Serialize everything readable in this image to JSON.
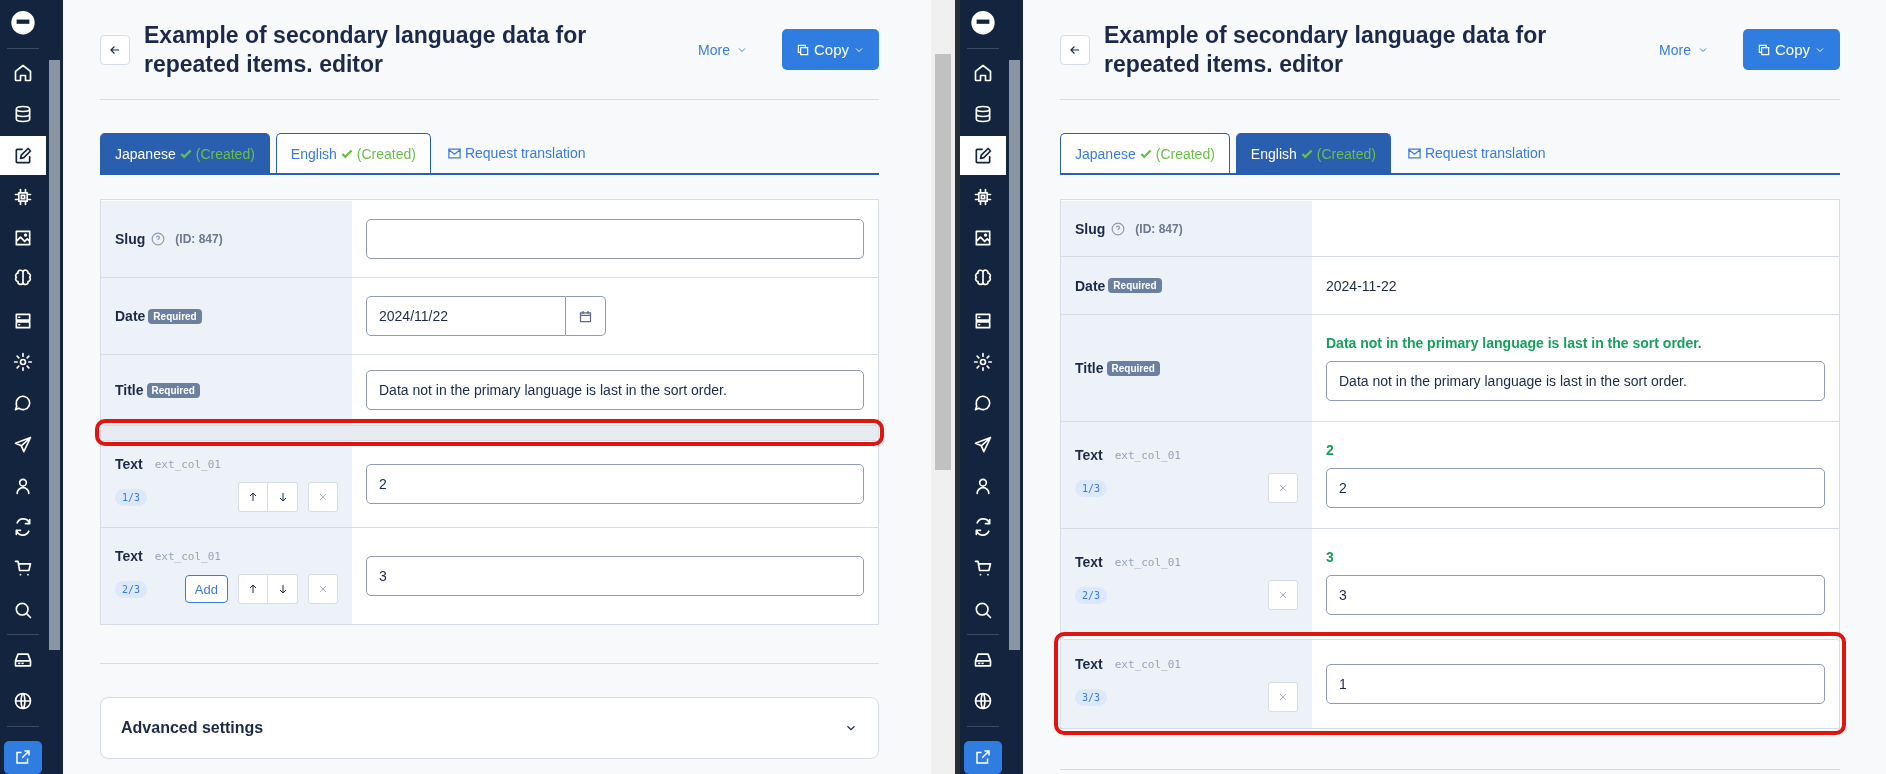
{
  "panels": [
    {
      "sidebar": {
        "items": [
          {
            "selected": false
          },
          {
            "selected": false
          },
          {
            "selected": true
          },
          {
            "selected": false
          },
          {
            "selected": false
          },
          {
            "selected": false
          },
          {
            "selected": false
          },
          {
            "selected": false
          },
          {
            "selected": false
          },
          {
            "selected": false
          },
          {
            "selected": false
          },
          {
            "selected": false
          },
          {
            "selected": false
          },
          {
            "selected": false
          },
          {
            "selected": false
          },
          {
            "selected": false
          }
        ]
      },
      "title": "Example of secondary language data for repeated items. editor",
      "more": "More",
      "copy": "Copy",
      "tabs": [
        {
          "label": "Japanese",
          "status": "(Created)",
          "selected": true
        },
        {
          "label": "English",
          "status": "(Created)",
          "selected": false
        }
      ],
      "request_translation": "Request translation",
      "rows": [
        {
          "kind": "slug",
          "label": "Slug",
          "note": "(ID: 847)",
          "editable": true,
          "highlighted": false
        },
        {
          "kind": "date",
          "label": "Date",
          "badge": "Required",
          "value": "2024/11/22",
          "editable": true,
          "highlighted": false
        },
        {
          "kind": "text",
          "label": "Title",
          "badge": "Required",
          "value": "Data not in the primary language is last in the sort order.",
          "highlighted": false
        },
        {
          "kind": "gap",
          "highlighted": true
        },
        {
          "kind": "repeat",
          "label": "Text",
          "code": "ext_col_01",
          "index": "1/3",
          "movable": true,
          "value": "2",
          "highlighted": false
        },
        {
          "kind": "repeat",
          "label": "Text",
          "code": "ext_col_01",
          "index": "2/3",
          "add": "Add",
          "movable": true,
          "value": "3",
          "highlighted": false
        }
      ],
      "advanced_settings": "Advanced settings"
    },
    {
      "sidebar": {
        "items": [
          {
            "selected": false
          },
          {
            "selected": false
          },
          {
            "selected": true
          },
          {
            "selected": false
          },
          {
            "selected": false
          },
          {
            "selected": false
          },
          {
            "selected": false
          },
          {
            "selected": false
          },
          {
            "selected": false
          },
          {
            "selected": false
          },
          {
            "selected": false
          },
          {
            "selected": false
          },
          {
            "selected": false
          },
          {
            "selected": false
          },
          {
            "selected": false
          },
          {
            "selected": false
          }
        ]
      },
      "title": "Example of secondary language data for repeated items. editor",
      "more": "More",
      "copy": "Copy",
      "tabs": [
        {
          "label": "Japanese",
          "status": "(Created)",
          "selected": false
        },
        {
          "label": "English",
          "status": "(Created)",
          "selected": true
        }
      ],
      "request_translation": "Request translation",
      "rows": [
        {
          "kind": "slug",
          "label": "Slug",
          "note": "(ID: 847)",
          "editable": false,
          "highlighted": false
        },
        {
          "kind": "date",
          "label": "Date",
          "badge": "Required",
          "value": "2024-11-22",
          "editable": false,
          "highlighted": false
        },
        {
          "kind": "text",
          "label": "Title",
          "badge": "Required",
          "source": "Data not in the primary language is last in the sort order.",
          "value": "Data not in the primary language is last in the sort order.",
          "highlighted": false
        },
        {
          "kind": "repeat",
          "label": "Text",
          "code": "ext_col_01",
          "index": "1/3",
          "movable": false,
          "source": "2",
          "value": "2",
          "highlighted": false
        },
        {
          "kind": "repeat",
          "label": "Text",
          "code": "ext_col_01",
          "index": "2/3",
          "movable": false,
          "source": "3",
          "value": "3",
          "highlighted": false
        },
        {
          "kind": "repeat",
          "label": "Text",
          "code": "ext_col_01",
          "index": "3/3",
          "movable": false,
          "value": "1",
          "highlighted": true
        }
      ]
    }
  ]
}
